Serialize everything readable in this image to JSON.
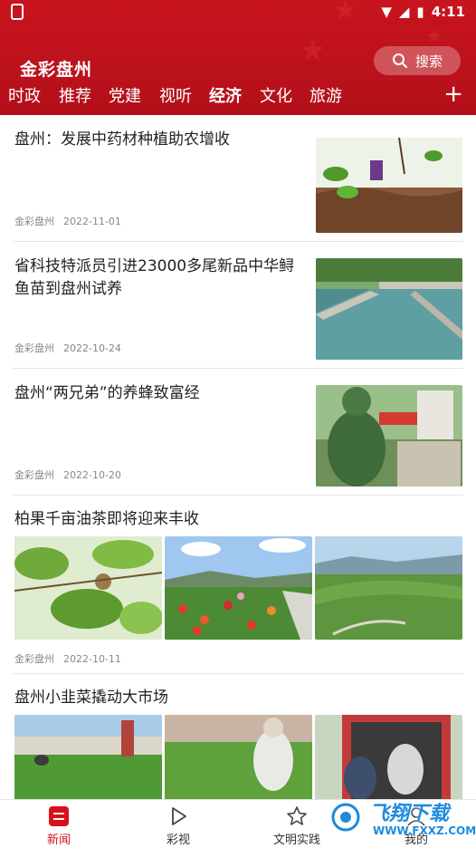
{
  "status": {
    "time": "4:11"
  },
  "header": {
    "brand": "金彩盘州",
    "search_label": "搜索"
  },
  "tabs": [
    {
      "label": "时政"
    },
    {
      "label": "推荐"
    },
    {
      "label": "党建"
    },
    {
      "label": "视听"
    },
    {
      "label": "经济",
      "active": true
    },
    {
      "label": "文化"
    },
    {
      "label": "旅游"
    }
  ],
  "add_tab_icon": "plus-icon",
  "news": [
    {
      "title": "盘州：发展中药材种植助农增收",
      "source": "金彩盘州",
      "date": "2022-11-01"
    },
    {
      "title_line1": "省科技特派员引进23000多尾新品中华鲟",
      "title_line2": "鱼苗到盘州试养",
      "source": "金彩盘州",
      "date": "2022-10-24"
    },
    {
      "title": "盘州“两兄弟”的养蜂致富经",
      "source": "金彩盘州",
      "date": "2022-10-20"
    },
    {
      "title": "柏果千亩油茶即将迎来丰收",
      "source": "金彩盘州",
      "date": "2022-10-11"
    },
    {
      "title": "盘州小韭菜撬动大市场"
    }
  ],
  "bottom_nav": [
    {
      "label": "新闻",
      "icon": "news-icon",
      "active": true
    },
    {
      "label": "彩视",
      "icon": "play-icon"
    },
    {
      "label": "文明实践",
      "icon": "star-icon"
    },
    {
      "label": "我的",
      "icon": "user-icon"
    }
  ],
  "watermark": {
    "text": "飞翔下载",
    "url": "WWW.FXXZ.COM"
  },
  "colors": {
    "brand_red": "#c9141f",
    "active_red": "#d7111a"
  }
}
